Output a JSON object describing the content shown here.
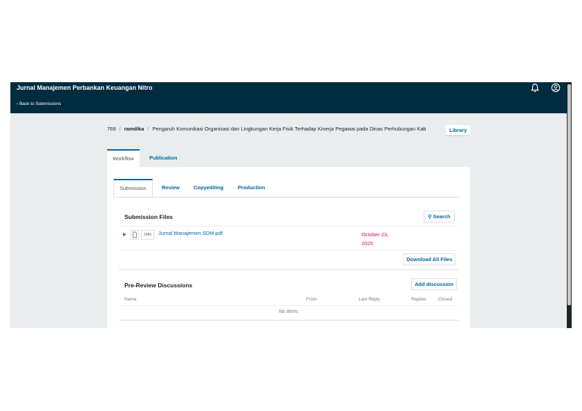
{
  "header": {
    "journal_title": "Jurnal Manajemen Perbankan Keuangan Nitro",
    "back_link": "‹  Back to Submissions",
    "bell_icon": "bell-icon",
    "user_icon": "user-circle-icon"
  },
  "breadcrumb": {
    "id": "769",
    "separator": "/",
    "author": "ramdika",
    "title": "Pengaruh Komunikasi Organisasi dan Lingkungan Kerja Fisik Terhadap Kinerja Pegawai pada Dinas Perhubungan Kab",
    "library_label": "Library"
  },
  "main_tabs": {
    "workflow": "Workflow",
    "publication": "Publication"
  },
  "sub_tabs": {
    "submission": "Submission",
    "review": "Review",
    "copyediting": "Copyediting",
    "production": "Production"
  },
  "submission_files": {
    "title": "Submission Files",
    "search_label": "Search",
    "files": [
      {
        "id": "1996",
        "name": "Jurnal Manajemen SDM.pdf",
        "date": "October 23, 2025"
      }
    ],
    "download_all_label": "Download All Files"
  },
  "discussions": {
    "title": "Pre-Review Discussions",
    "add_label": "Add discussion",
    "columns": {
      "name": "Name",
      "from": "From",
      "last_reply": "Last Reply",
      "replies": "Replies",
      "closed": "Closed"
    },
    "empty_text": "No Items"
  },
  "colors": {
    "header_bg": "#002c40",
    "link": "#006798",
    "date": "#d00a6c",
    "page_bg": "#eaedee"
  }
}
